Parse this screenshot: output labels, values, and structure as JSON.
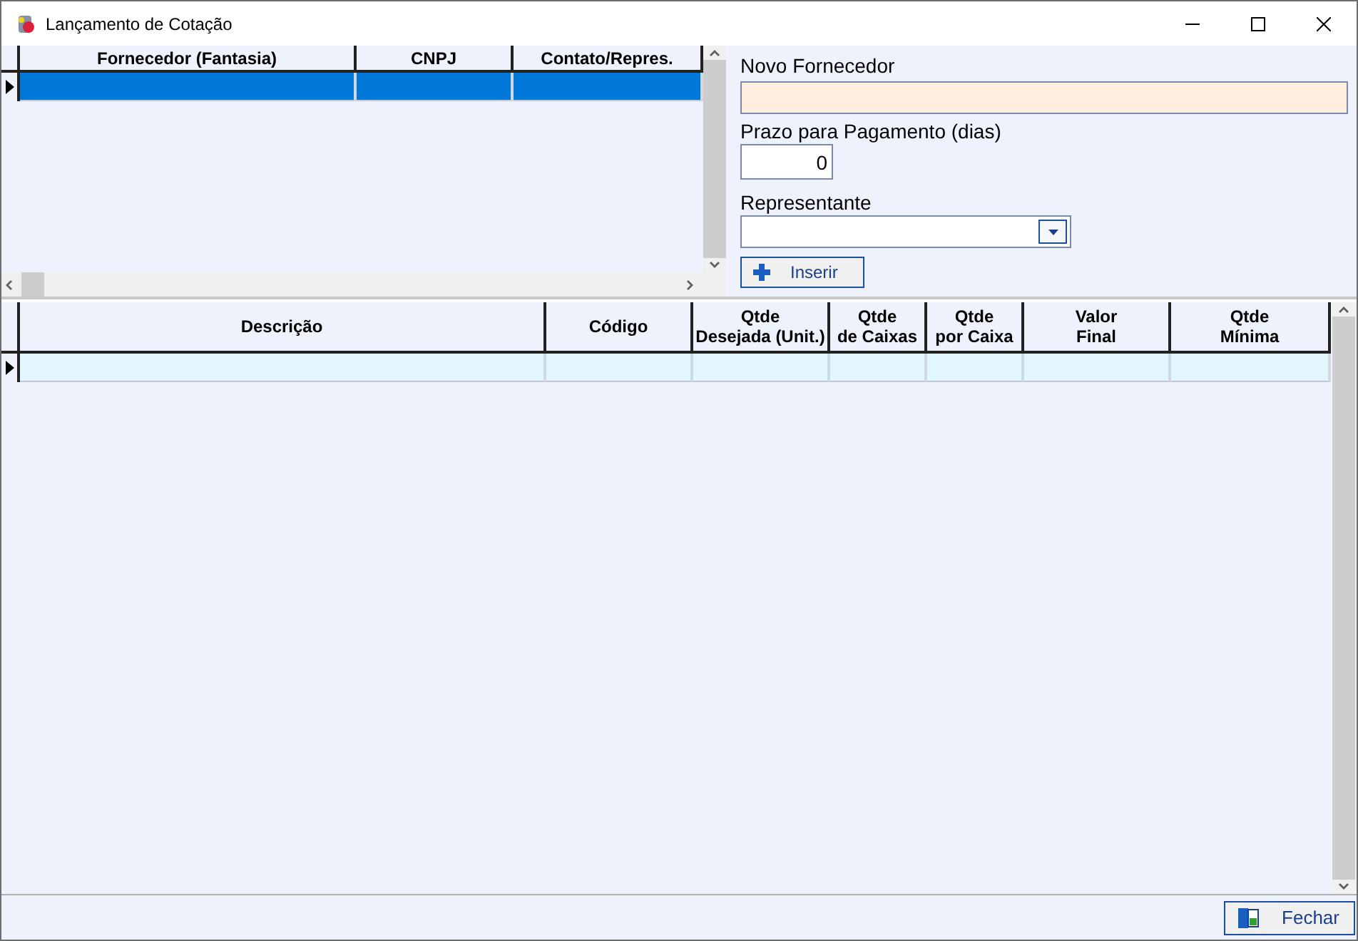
{
  "window": {
    "title": "Lançamento de Cotação"
  },
  "suppliers_grid": {
    "columns": [
      {
        "label": "Fornecedor (Fantasia)"
      },
      {
        "label": "CNPJ"
      },
      {
        "label": "Contato/Repres."
      }
    ],
    "rows": [
      {
        "selected": true
      }
    ]
  },
  "form": {
    "new_supplier_label": "Novo Fornecedor",
    "payment_term_label": "Prazo para Pagamento (dias)",
    "payment_term_value": "0",
    "representative_label": "Representante",
    "insert_button": "Inserir"
  },
  "items_grid": {
    "columns": [
      {
        "label": "Descrição"
      },
      {
        "label": "Código"
      },
      {
        "label": "Qtde\nDesejada (Unit.)"
      },
      {
        "label": "Qtde\nde Caixas"
      },
      {
        "label": "Qtde\npor Caixa"
      },
      {
        "label": "Valor\nFinal"
      },
      {
        "label": "Qtde\nMínima"
      }
    ],
    "rows": [
      {
        "selected": false
      }
    ]
  },
  "close_button": "Fechar"
}
